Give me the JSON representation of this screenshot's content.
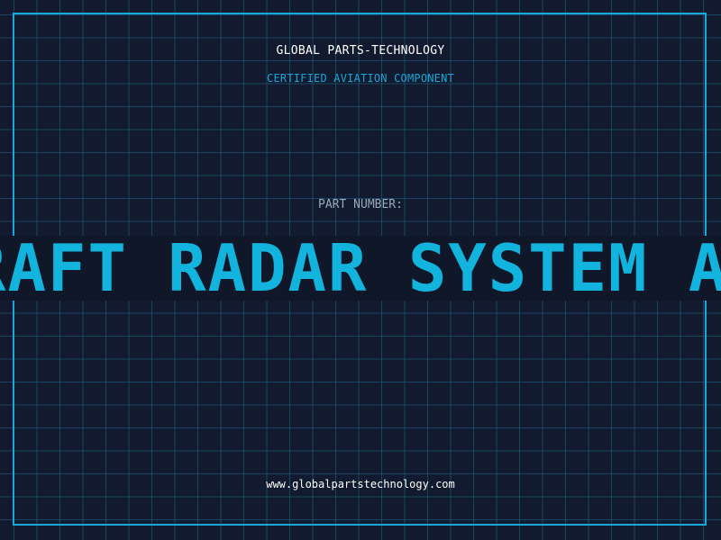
{
  "header": {
    "company": "GLOBAL PARTS-TECHNOLOGY",
    "subtitle": "CERTIFIED AVIATION COMPONENT"
  },
  "part": {
    "label": "PART NUMBER:",
    "ticker_text": "RAFT RADAR SYSTEM A"
  },
  "footer": {
    "url": "www.globalpartstechnology.com"
  },
  "colors": {
    "background": "#111a2e",
    "grid": "#1d5c7a",
    "accent": "#1aa7d9",
    "ticker_text": "#12b3dd",
    "label_gray": "#9aa8bb"
  }
}
